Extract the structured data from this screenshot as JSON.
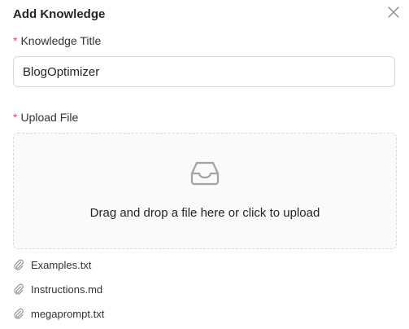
{
  "dialog": {
    "title": "Add Knowledge",
    "close_icon": "close-icon"
  },
  "form": {
    "title_field": {
      "required_mark": "*",
      "label": "Knowledge Title",
      "value": "BlogOptimizer"
    },
    "upload_field": {
      "required_mark": "*",
      "label": "Upload File",
      "icon": "inbox-icon",
      "hint": "Drag and drop a file here or click to upload"
    }
  },
  "files": [
    {
      "name": "Examples.txt",
      "icon": "paperclip-icon"
    },
    {
      "name": "Instructions.md",
      "icon": "paperclip-icon"
    },
    {
      "name": "megaprompt.txt",
      "icon": "paperclip-icon"
    }
  ],
  "colors": {
    "required": "#e5484d",
    "border": "#d9d9d9",
    "icon": "#a3a3a3"
  }
}
